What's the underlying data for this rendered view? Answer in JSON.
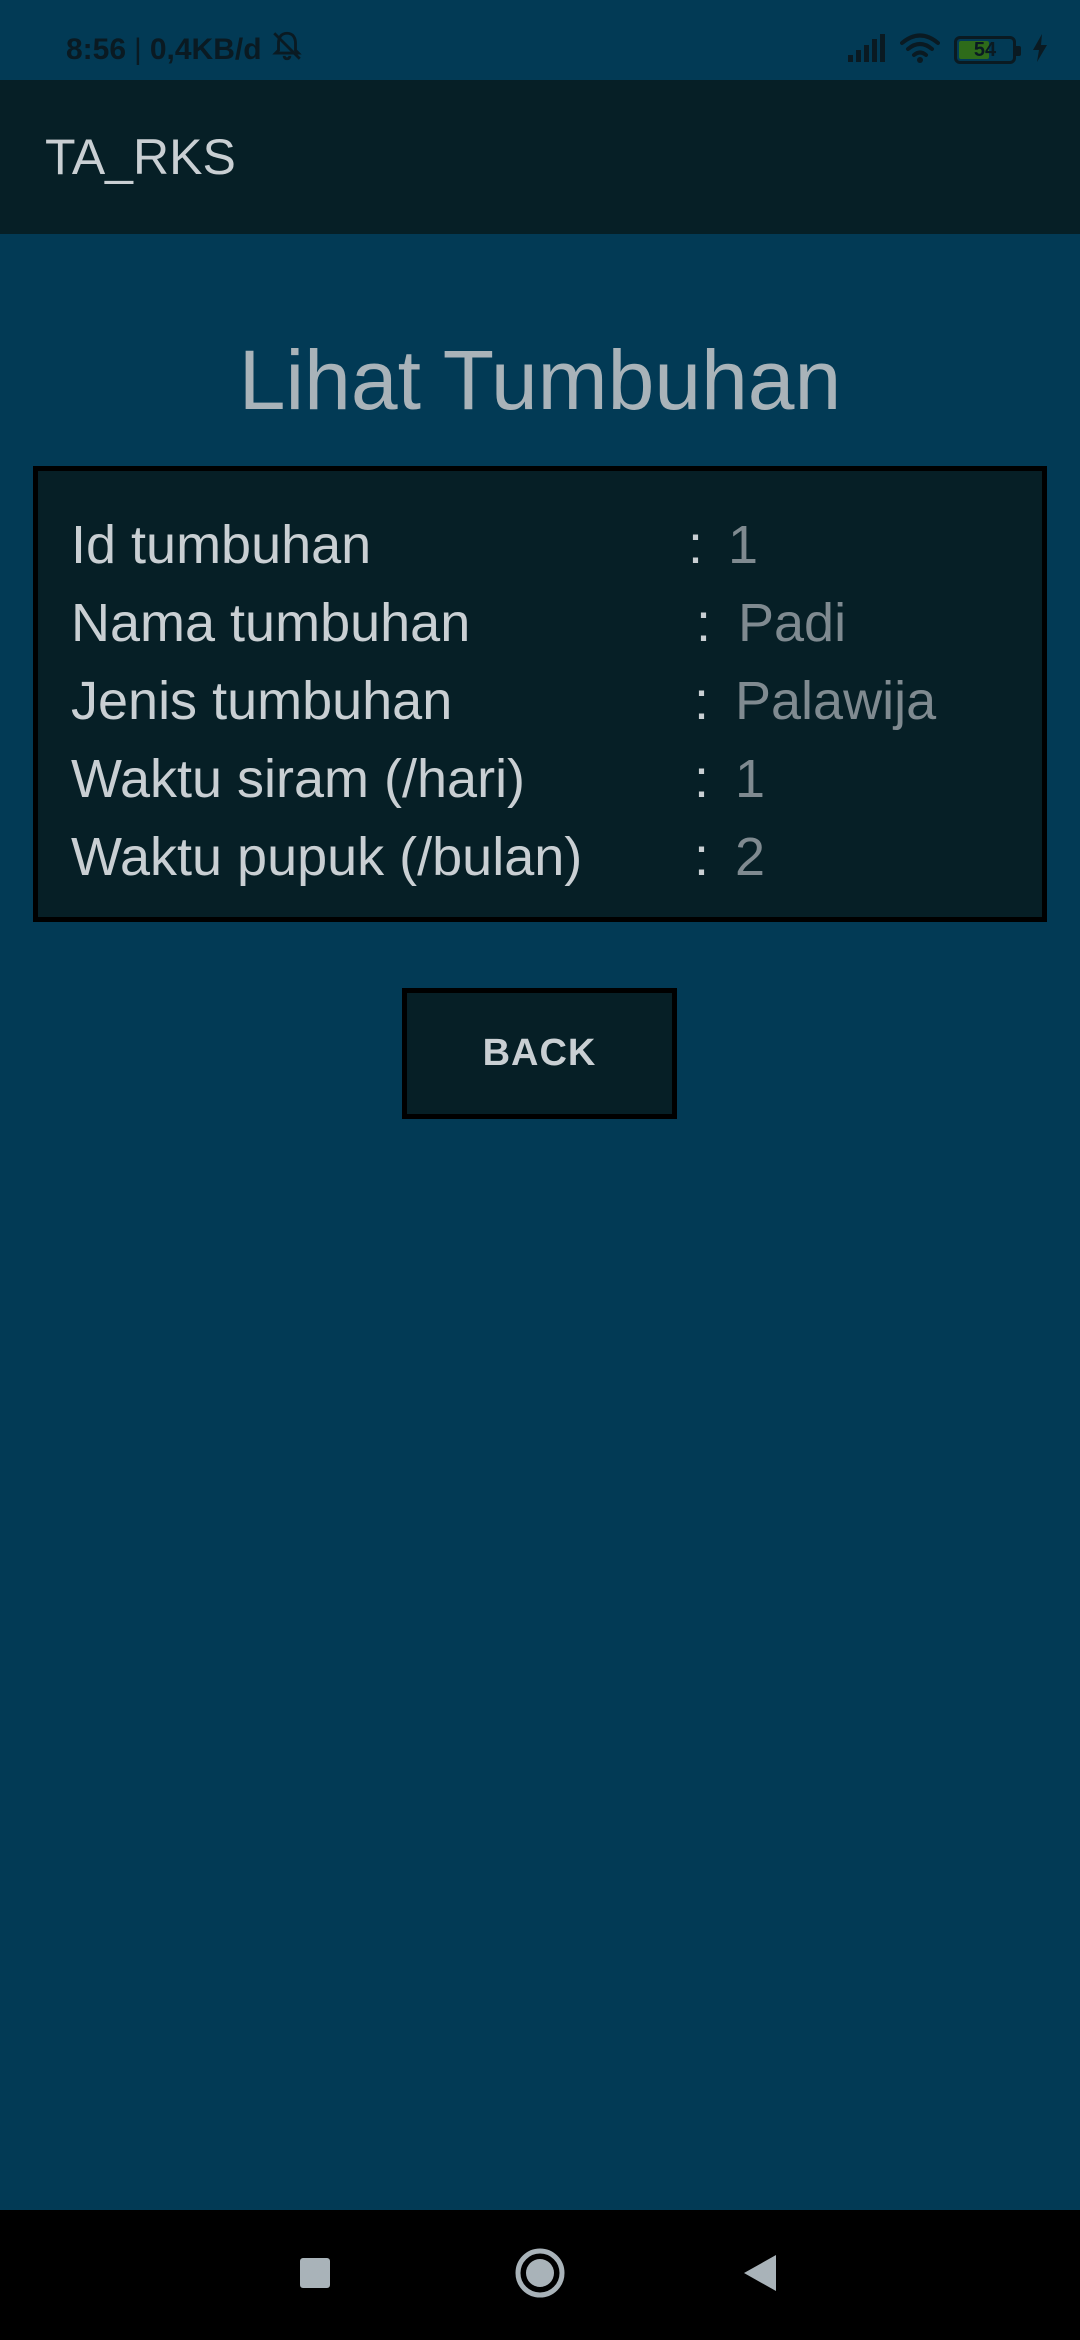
{
  "status_bar": {
    "time": "8:56",
    "separator": "|",
    "network_speed": "0,4KB/d",
    "battery_level": "54",
    "battery_fraction": 0.54,
    "icons": [
      "bell-off-icon",
      "signal-icon",
      "wifi-icon",
      "battery-icon",
      "charging-icon"
    ]
  },
  "app_bar": {
    "title": "TA_RKS"
  },
  "page": {
    "heading": "Lihat Tumbuhan"
  },
  "details": {
    "rows": [
      {
        "label": "Id tumbuhan",
        "colon": ":",
        "value": "1"
      },
      {
        "label": "Nama tumbuhan",
        "colon": ":",
        "value": "Padi"
      },
      {
        "label": "Jenis tumbuhan",
        "colon": ":",
        "value": "Palawija"
      },
      {
        "label": "Waktu siram (/hari)",
        "colon": ":",
        "value": "1"
      },
      {
        "label": "Waktu pupuk (/bulan)",
        "colon": ":",
        "value": "2"
      }
    ]
  },
  "actions": {
    "back_label": "BACK"
  },
  "nav_bar": {
    "icons": [
      "recent-apps-icon",
      "home-icon",
      "back-icon"
    ]
  },
  "colors": {
    "background": "#023a55",
    "app_bar": "#061f26",
    "card": "#061f26",
    "label_text": "#c9cfd3",
    "value_text": "#7f8a90"
  }
}
